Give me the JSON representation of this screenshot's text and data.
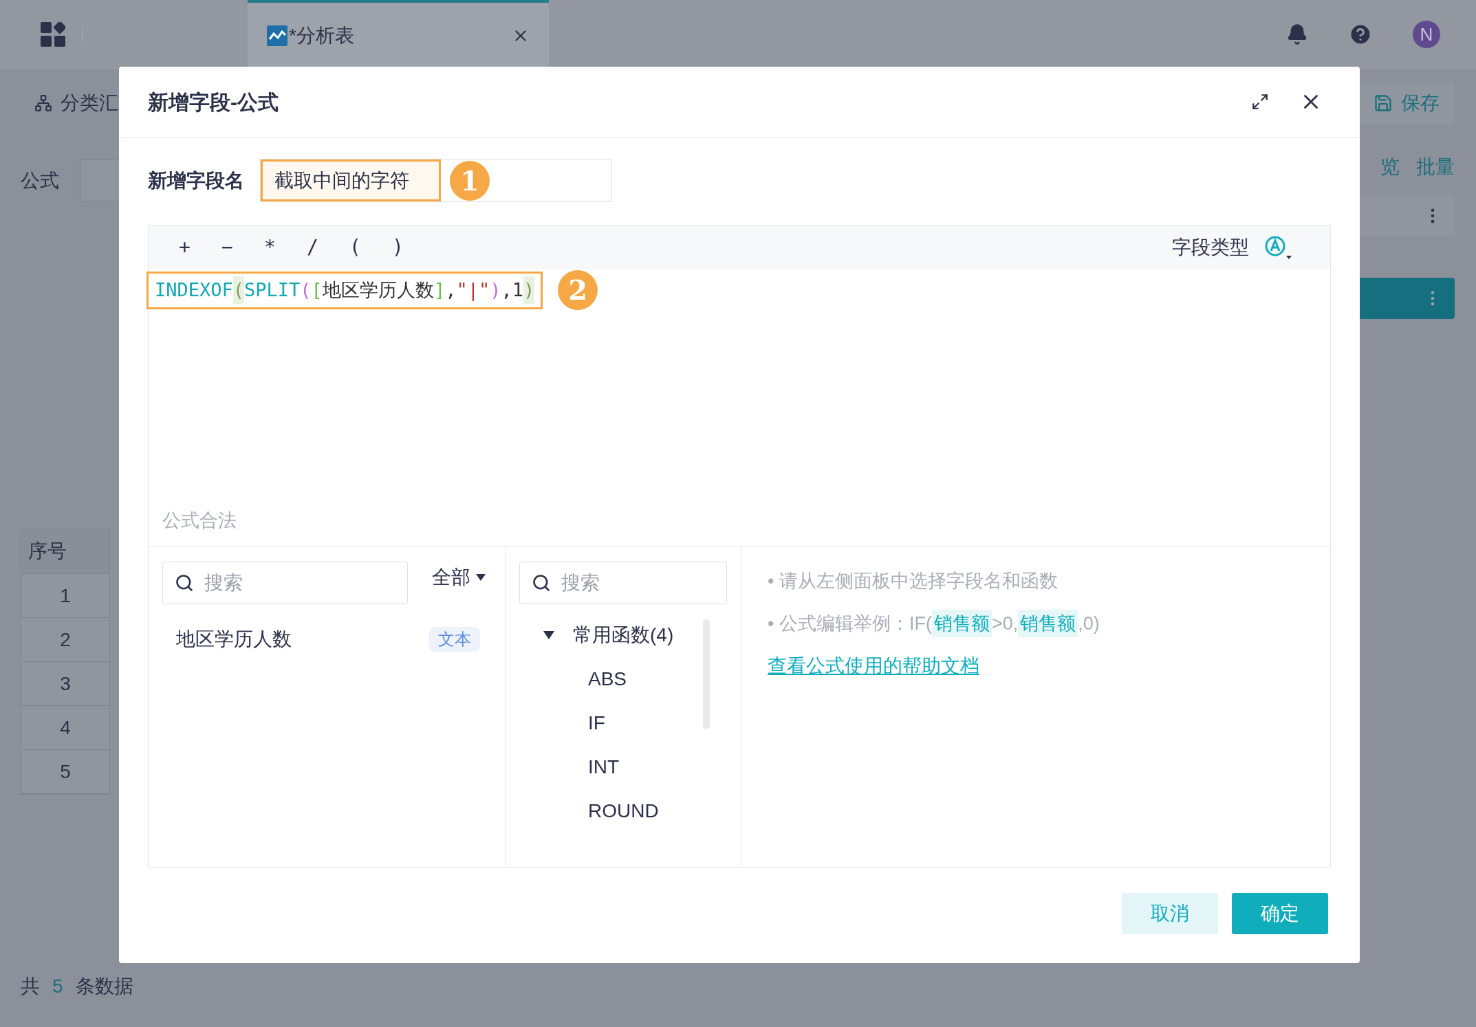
{
  "app_bar": {
    "tab": {
      "title": "*分析表",
      "selected": true
    },
    "avatar": "N"
  },
  "toolbar": {
    "left_button": "分类汇",
    "save_button": "保存",
    "links": [
      "览",
      "批量"
    ]
  },
  "formula_label": "公式",
  "table": {
    "columns": [
      "序号"
    ],
    "rows": [
      "1",
      "2",
      "3",
      "4",
      "5"
    ]
  },
  "footer": {
    "prefix": "共",
    "count": "5",
    "suffix": "条数据"
  },
  "dialog": {
    "title": "新增字段-公式",
    "name_label": "新增字段名",
    "name_value": "截取中间的字符",
    "name_step": "1",
    "operators": [
      "+",
      "−",
      "*",
      "/",
      "(",
      ")"
    ],
    "field_type_label": "字段类型",
    "formula_tokens": [
      {
        "kind": "func",
        "text": "INDEXOF"
      },
      {
        "kind": "outer",
        "text": "("
      },
      {
        "kind": "func",
        "text": "SPLIT"
      },
      {
        "kind": "inner",
        "text": "("
      },
      {
        "kind": "bracket",
        "text": "["
      },
      {
        "kind": "field",
        "text": "地区学历人数"
      },
      {
        "kind": "bracket",
        "text": "]"
      },
      {
        "kind": "plain",
        "text": ","
      },
      {
        "kind": "string",
        "text": "\"|\""
      },
      {
        "kind": "inner",
        "text": ")"
      },
      {
        "kind": "plain",
        "text": ",1"
      },
      {
        "kind": "outer",
        "text": ")"
      }
    ],
    "formula_step": "2",
    "status": "公式合法",
    "field_search": {
      "placeholder": "搜索"
    },
    "filter": "全部",
    "fields": [
      {
        "name": "地区学历人数",
        "tag": "文本"
      }
    ],
    "function_search": {
      "placeholder": "搜索"
    },
    "function_groups": [
      {
        "label": "常用函数(4)",
        "expanded": true,
        "children": [
          "ABS",
          "IF",
          "INT",
          "ROUND"
        ]
      }
    ],
    "hints": [
      [
        {
          "kind": "text",
          "text": "• 请从左侧面板中选择字段名和函数"
        }
      ],
      [
        {
          "kind": "text",
          "text": "• 公式编辑举例：IF("
        },
        {
          "kind": "field",
          "text": "销售额"
        },
        {
          "kind": "text",
          "text": ">0,"
        },
        {
          "kind": "field",
          "text": "销售额"
        },
        {
          "kind": "text",
          "text": ",0)"
        }
      ]
    ],
    "help_link": "查看公式使用的帮助文档",
    "buttons": [
      {
        "label": "取消",
        "kind": "secondary"
      },
      {
        "label": "确定",
        "kind": "primary"
      }
    ]
  }
}
